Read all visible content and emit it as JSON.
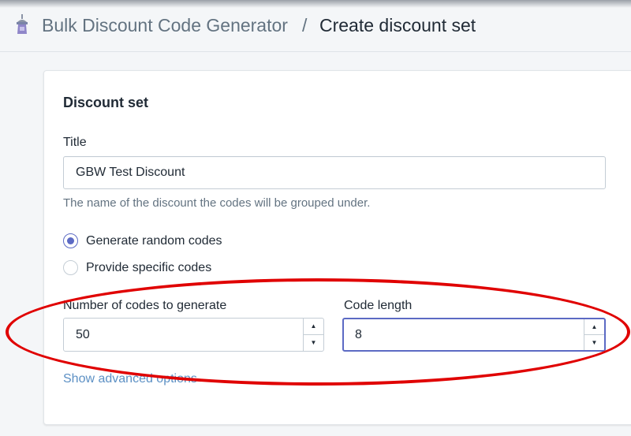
{
  "header": {
    "app_icon": "app-logo-icon",
    "app_name": "Bulk Discount Code Generator",
    "separator": "/",
    "page_title": "Create discount set"
  },
  "form": {
    "section_title": "Discount set",
    "title_label": "Title",
    "title_value": "GBW Test Discount",
    "title_help": "The name of the discount the codes will be grouped under.",
    "radio_options": [
      {
        "label": "Generate random codes",
        "checked": true
      },
      {
        "label": "Provide specific codes",
        "checked": false
      }
    ],
    "num_codes_label": "Number of codes to generate",
    "num_codes_value": "50",
    "code_length_label": "Code length",
    "code_length_value": "8",
    "stepper_up": "▲",
    "stepper_down": "▼",
    "advanced_link": "Show advanced options"
  },
  "colors": {
    "accent": "#5c6ac4",
    "annotation": "#e00000",
    "link": "#5c90c4"
  }
}
